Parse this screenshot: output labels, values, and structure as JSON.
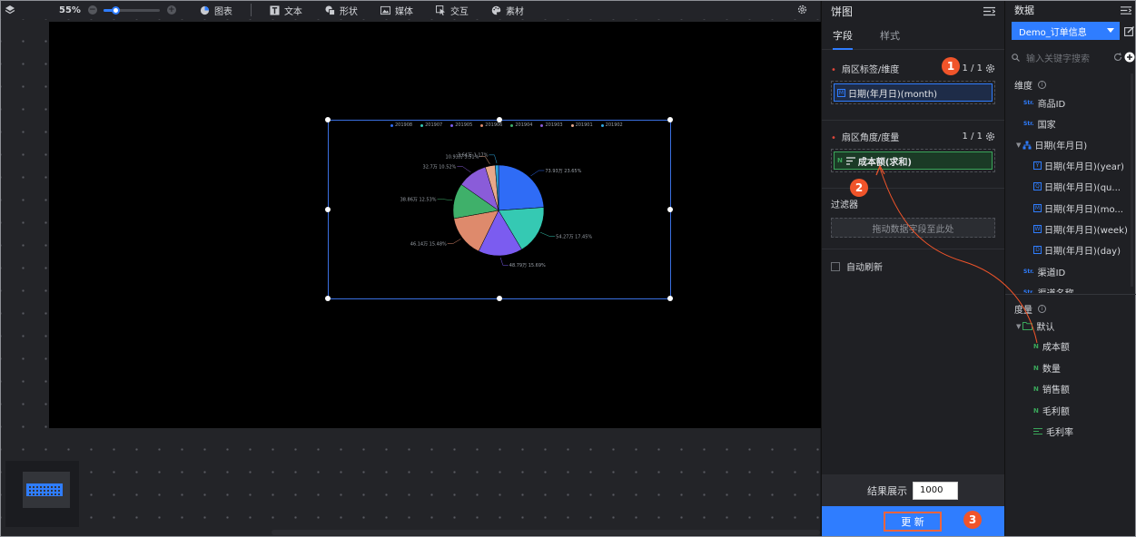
{
  "toolbar": {
    "zoom": "55%",
    "items": [
      {
        "label": "图表",
        "icon": "pie-chart-icon"
      },
      {
        "label": "文本",
        "icon": "text-icon"
      },
      {
        "label": "形状",
        "icon": "shape-icon"
      },
      {
        "label": "媒体",
        "icon": "image-icon"
      },
      {
        "label": "交互",
        "icon": "interaction-icon"
      },
      {
        "label": "素材",
        "icon": "palette-icon"
      }
    ]
  },
  "chart_data": {
    "type": "pie",
    "categories": [
      "201908",
      "201907",
      "201905",
      "201906",
      "201904",
      "201903",
      "201901",
      "201902"
    ],
    "values": [
      73.93,
      54.27,
      48.79,
      46.14,
      38.86,
      32.7,
      10.93,
      3.64
    ],
    "percent_labels": [
      "23.65%",
      "17.45%",
      "15.69%",
      "15.48%",
      "12.53%",
      "10.52%",
      "3.51%",
      "1.17%"
    ],
    "data_labels": [
      "73.93万 23.65%",
      "54.27万 17.45%",
      "48.79万 15.69%",
      "46.14万 15.48%",
      "38.86万 12.53%",
      "32.7万 10.52%",
      "10.93万 3.51%",
      "3.64万 1.17%"
    ],
    "legend": [
      "201908",
      "201907",
      "201905",
      "201906",
      "201904",
      "201903",
      "201901",
      "201902"
    ],
    "legend_position": "top",
    "colors": [
      "#2f6cf6",
      "#35c9b3",
      "#7b5cf0",
      "#de8a6c",
      "#3fb06a",
      "#8a5cd9",
      "#e8a88a",
      "#2fa8e0"
    ]
  },
  "config": {
    "title": "饼图",
    "tabs": [
      "字段",
      "样式"
    ],
    "sections": {
      "dimension": {
        "title": "扇区标签/维度",
        "count": "1 / 1",
        "field": "日期(年月日)(month)",
        "type_tag": "M"
      },
      "measure": {
        "title": "扇区角度/度量",
        "count": "1 / 1",
        "field": "成本额(求和)",
        "type_tag": "N"
      },
      "filter": {
        "title": "过滤器",
        "placeholder": "拖动数据字段至此处"
      },
      "auto_refresh": {
        "label": "自动刷新"
      }
    },
    "result_label": "结果展示",
    "result_value": "1000",
    "update_label": "更 新",
    "badges": [
      "1",
      "2",
      "3"
    ]
  },
  "data_panel": {
    "title": "数据",
    "dataset": "Demo_订单信息",
    "search_placeholder": "输入关键字搜索",
    "dimension_title": "维度",
    "dimensions": [
      {
        "label": "商品ID",
        "tag": "Str."
      },
      {
        "label": "国家",
        "tag": "Str."
      },
      {
        "label": "日期(年月日)",
        "tag": "tree"
      },
      {
        "label": "日期(年月日)(year)",
        "tag": "Y"
      },
      {
        "label": "日期(年月日)(qu...",
        "tag": "Q"
      },
      {
        "label": "日期(年月日)(mo...",
        "tag": "M"
      },
      {
        "label": "日期(年月日)(week)",
        "tag": "W"
      },
      {
        "label": "日期(年月日)(day)",
        "tag": "D"
      },
      {
        "label": "渠道ID",
        "tag": "Str."
      },
      {
        "label": "渠道名称",
        "tag": "Str."
      }
    ],
    "measure_title": "度量",
    "measure_folder": "默认",
    "measures": [
      {
        "label": "成本额",
        "tag": "N"
      },
      {
        "label": "数量",
        "tag": "N"
      },
      {
        "label": "销售额",
        "tag": "N"
      },
      {
        "label": "毛利额",
        "tag": "N"
      },
      {
        "label": "毛利率",
        "tag": "calc"
      }
    ]
  }
}
